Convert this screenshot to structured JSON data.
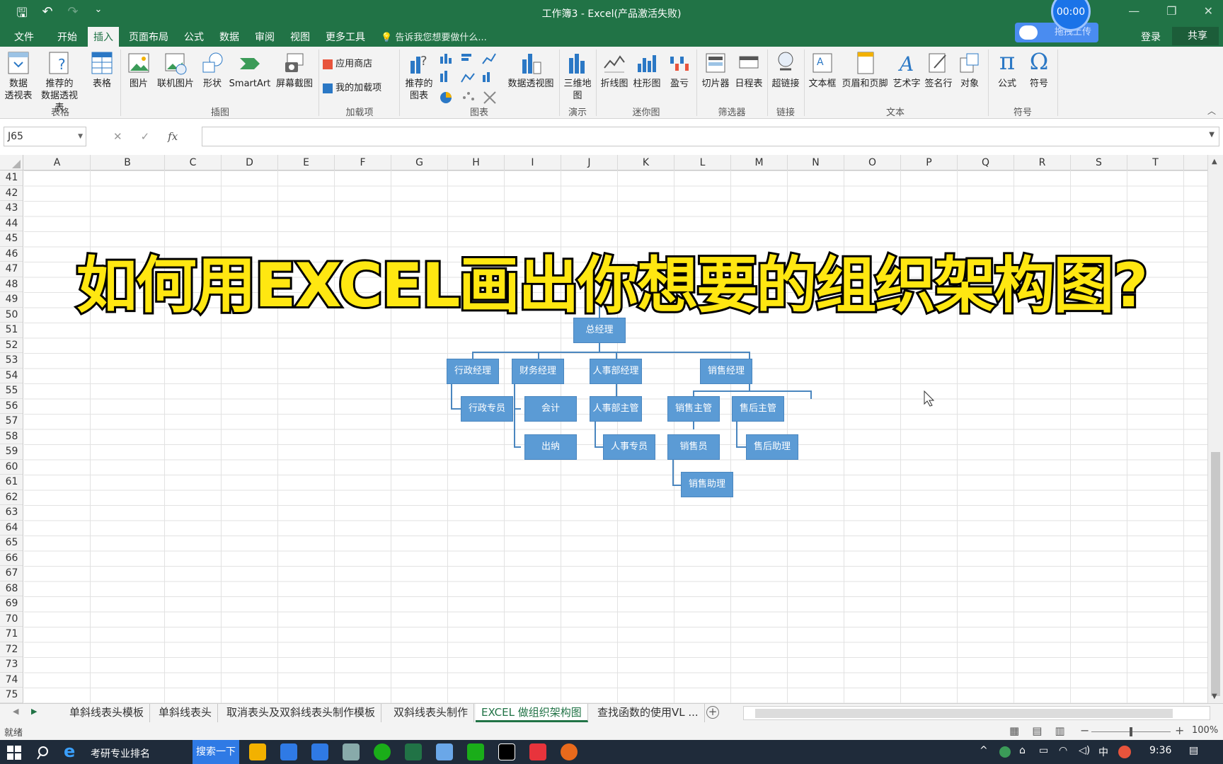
{
  "titlebar": {
    "title": "工作簿3 - Excel(产品激活失败)",
    "timer": "00:00",
    "qat_save": "🖫",
    "qat_undo": "↶",
    "qat_redo": "↷",
    "qat_more": "⌄",
    "win_min": "—",
    "win_restore": "❐",
    "win_close": "✕"
  },
  "tabs": {
    "file": "文件",
    "home": "开始",
    "insert": "插入",
    "layout": "页面布局",
    "formulas": "公式",
    "data": "数据",
    "review": "审阅",
    "view": "视图",
    "more": "更多工具",
    "tellme": "告诉我您想要做什么..."
  },
  "topright": {
    "upload": "拖拽上传",
    "login": "登录",
    "share": "共享"
  },
  "ribbon": {
    "pivot": "数据\n透视表",
    "recommended_pivot": "推荐的\n数据透视表",
    "table": "表格",
    "group_tables": "表格",
    "picture": "图片",
    "online_picture": "联机图片",
    "shapes": "形状",
    "smartart": "SmartArt",
    "screenshot": "屏幕截图",
    "group_illustrations": "插图",
    "store": "应用商店",
    "my_addins": "我的加载项",
    "group_addins": "加载项",
    "recommended_charts": "推荐的\n图表",
    "pivot_chart": "数据透视图",
    "group_charts": "图表",
    "map3d": "三维地\n图",
    "group_tours": "演示",
    "spark_line": "折线图",
    "spark_column": "柱形图",
    "spark_winloss": "盈亏",
    "group_sparklines": "迷你图",
    "slicer": "切片器",
    "timeline": "日程表",
    "group_filters": "筛选器",
    "hyperlink": "超链接",
    "group_links": "链接",
    "textbox": "文本框",
    "header_footer": "页眉和页脚",
    "wordart": "艺术字",
    "signature": "签名行",
    "object": "对象",
    "group_text": "文本",
    "equation": "公式",
    "symbol": "符号",
    "group_symbols": "符号"
  },
  "formula": {
    "namebox": "J65",
    "value": ""
  },
  "grid": {
    "columns": [
      "A",
      "B",
      "C",
      "D",
      "E",
      "F",
      "G",
      "H",
      "I",
      "J",
      "K",
      "L",
      "M",
      "N",
      "O",
      "P",
      "Q",
      "R",
      "S",
      "T"
    ],
    "rows": [
      "41",
      "42",
      "43",
      "44",
      "45",
      "46",
      "47",
      "48",
      "49",
      "50",
      "51",
      "52",
      "53",
      "54",
      "55",
      "56",
      "57",
      "58",
      "59",
      "60",
      "61",
      "62",
      "63",
      "64",
      "65",
      "66",
      "67",
      "68",
      "69",
      "70",
      "71",
      "72",
      "73",
      "74",
      "75"
    ]
  },
  "overlay_title": "如何用EXCEL画出你想要的组织架构图?",
  "orgchart": {
    "ceo": "总经理",
    "admin_mgr": "行政经理",
    "finance_mgr": "财务经理",
    "hr_mgr": "人事部经理",
    "sales_mgr": "销售经理",
    "admin_staff": "行政专员",
    "accountant": "会计",
    "cashier": "出纳",
    "hr_supervisor": "人事部主管",
    "hr_staff": "人事专员",
    "sales_supervisor": "销售主管",
    "salesperson": "销售员",
    "sales_assistant": "销售助理",
    "aftersales_supervisor": "售后主管",
    "aftersales_assistant": "售后助理"
  },
  "sheets": {
    "tabs": [
      "单斜线表头模板",
      "单斜线表头",
      "取消表头及双斜线表头制作模板",
      "双斜线表头制作",
      "EXCEL 做组织架构图",
      "查找函数的使用VL ..."
    ],
    "active": "EXCEL 做组织架构图",
    "add": "+"
  },
  "status": {
    "ready": "就绪",
    "zoom": "100%",
    "zoom_minus": "−",
    "zoom_plus": "+"
  },
  "taskbar": {
    "browser_tab": "考研专业排名",
    "search_btn": "搜索一下",
    "ime": "中",
    "time": "9:36",
    "tray_up": "^"
  },
  "colors": {
    "excel_green": "#217346",
    "node_blue": "#5b9bd5",
    "title_yellow": "#ffe711"
  }
}
